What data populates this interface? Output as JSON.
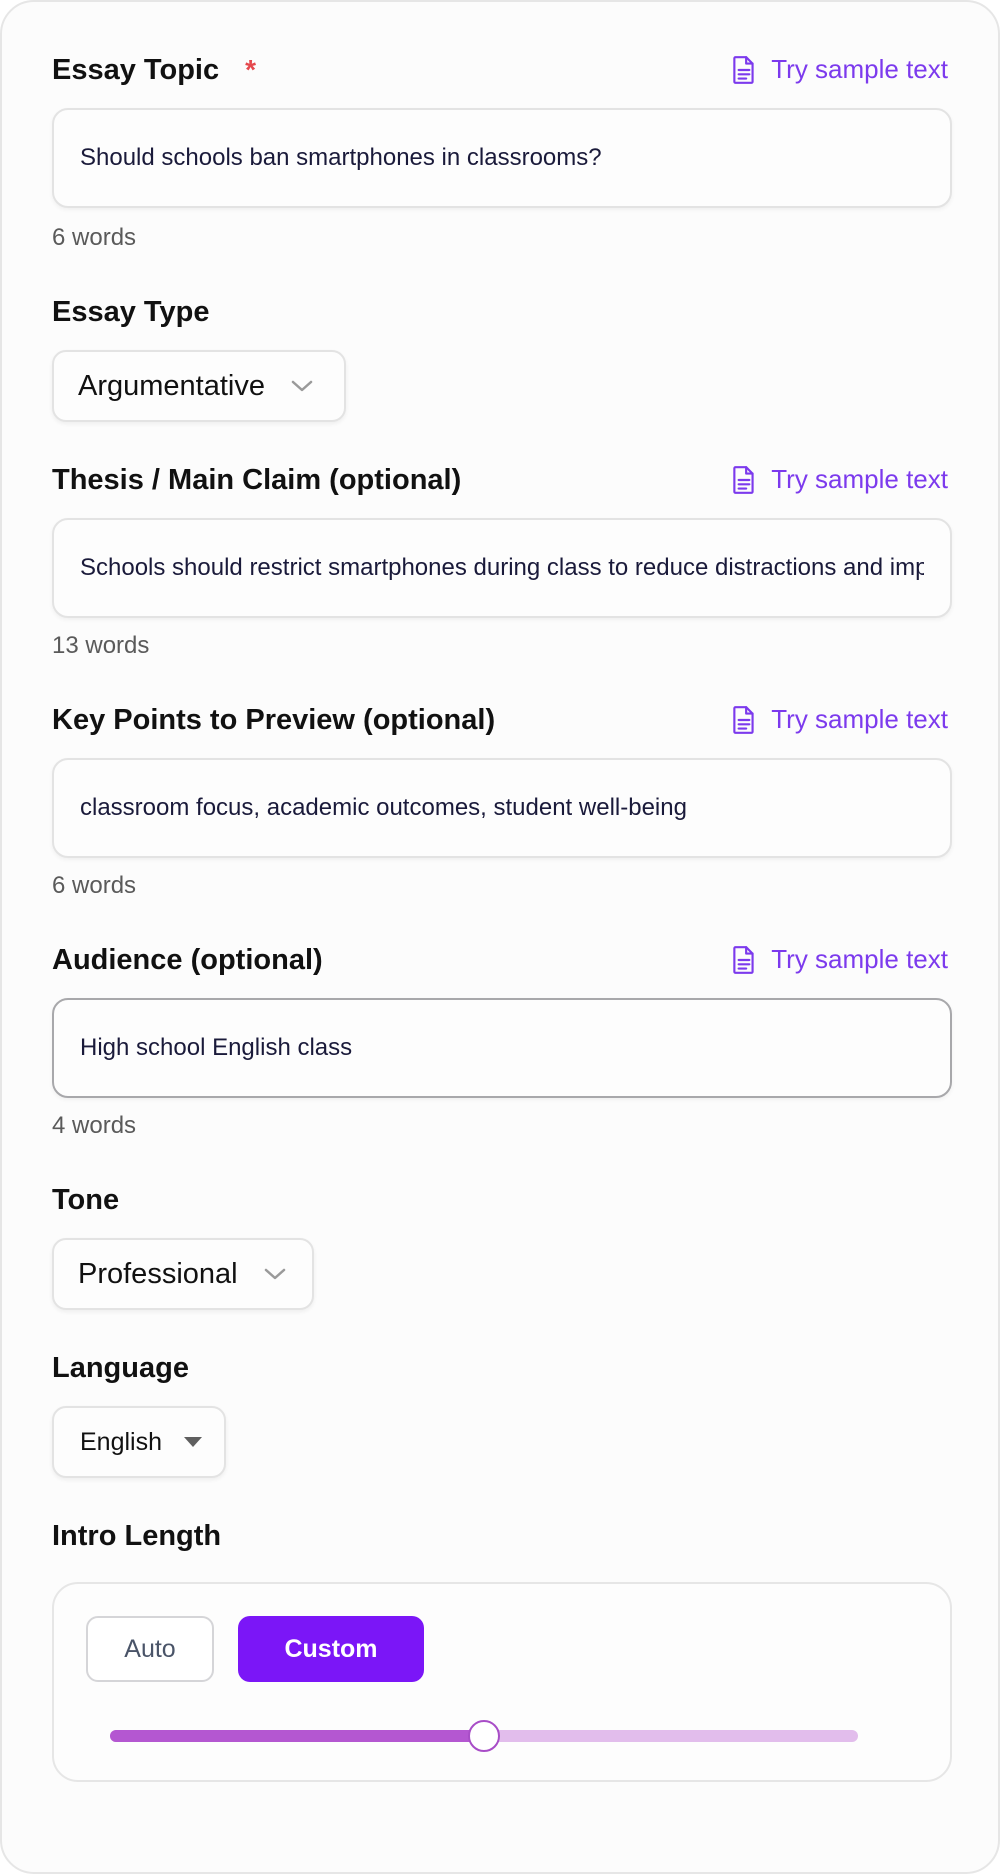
{
  "sample_link": "Try sample text",
  "topic": {
    "label": "Essay Topic",
    "required_mark": "*",
    "value": "Should schools ban smartphones in classrooms?",
    "word_count": "6 words"
  },
  "essay_type": {
    "label": "Essay Type",
    "selected": "Argumentative"
  },
  "thesis": {
    "label": "Thesis / Main Claim (optional)",
    "value": "Schools should restrict smartphones during class to reduce distractions and improve learning.",
    "word_count": "13 words"
  },
  "key_points": {
    "label": "Key Points to Preview (optional)",
    "value": "classroom focus, academic outcomes, student well-being",
    "word_count": "6 words"
  },
  "audience": {
    "label": "Audience (optional)",
    "value": "High school English class",
    "word_count": "4 words"
  },
  "tone": {
    "label": "Tone",
    "selected": "Professional"
  },
  "language": {
    "label": "Language",
    "selected": "English"
  },
  "intro_length": {
    "label": "Intro Length",
    "modes": [
      "Auto",
      "Custom"
    ],
    "active_mode": "Custom",
    "slider_fraction": 0.5
  },
  "icons": {
    "sample": "document-icon",
    "select_chevron": "chevron-down-icon",
    "language_caret": "caret-down-icon"
  },
  "colors": {
    "accent": "#7c3aed",
    "button_active": "#7b16f7",
    "required": "#e5484d",
    "slider_fill": "#b457d1",
    "slider_track": "#e2bdec"
  }
}
